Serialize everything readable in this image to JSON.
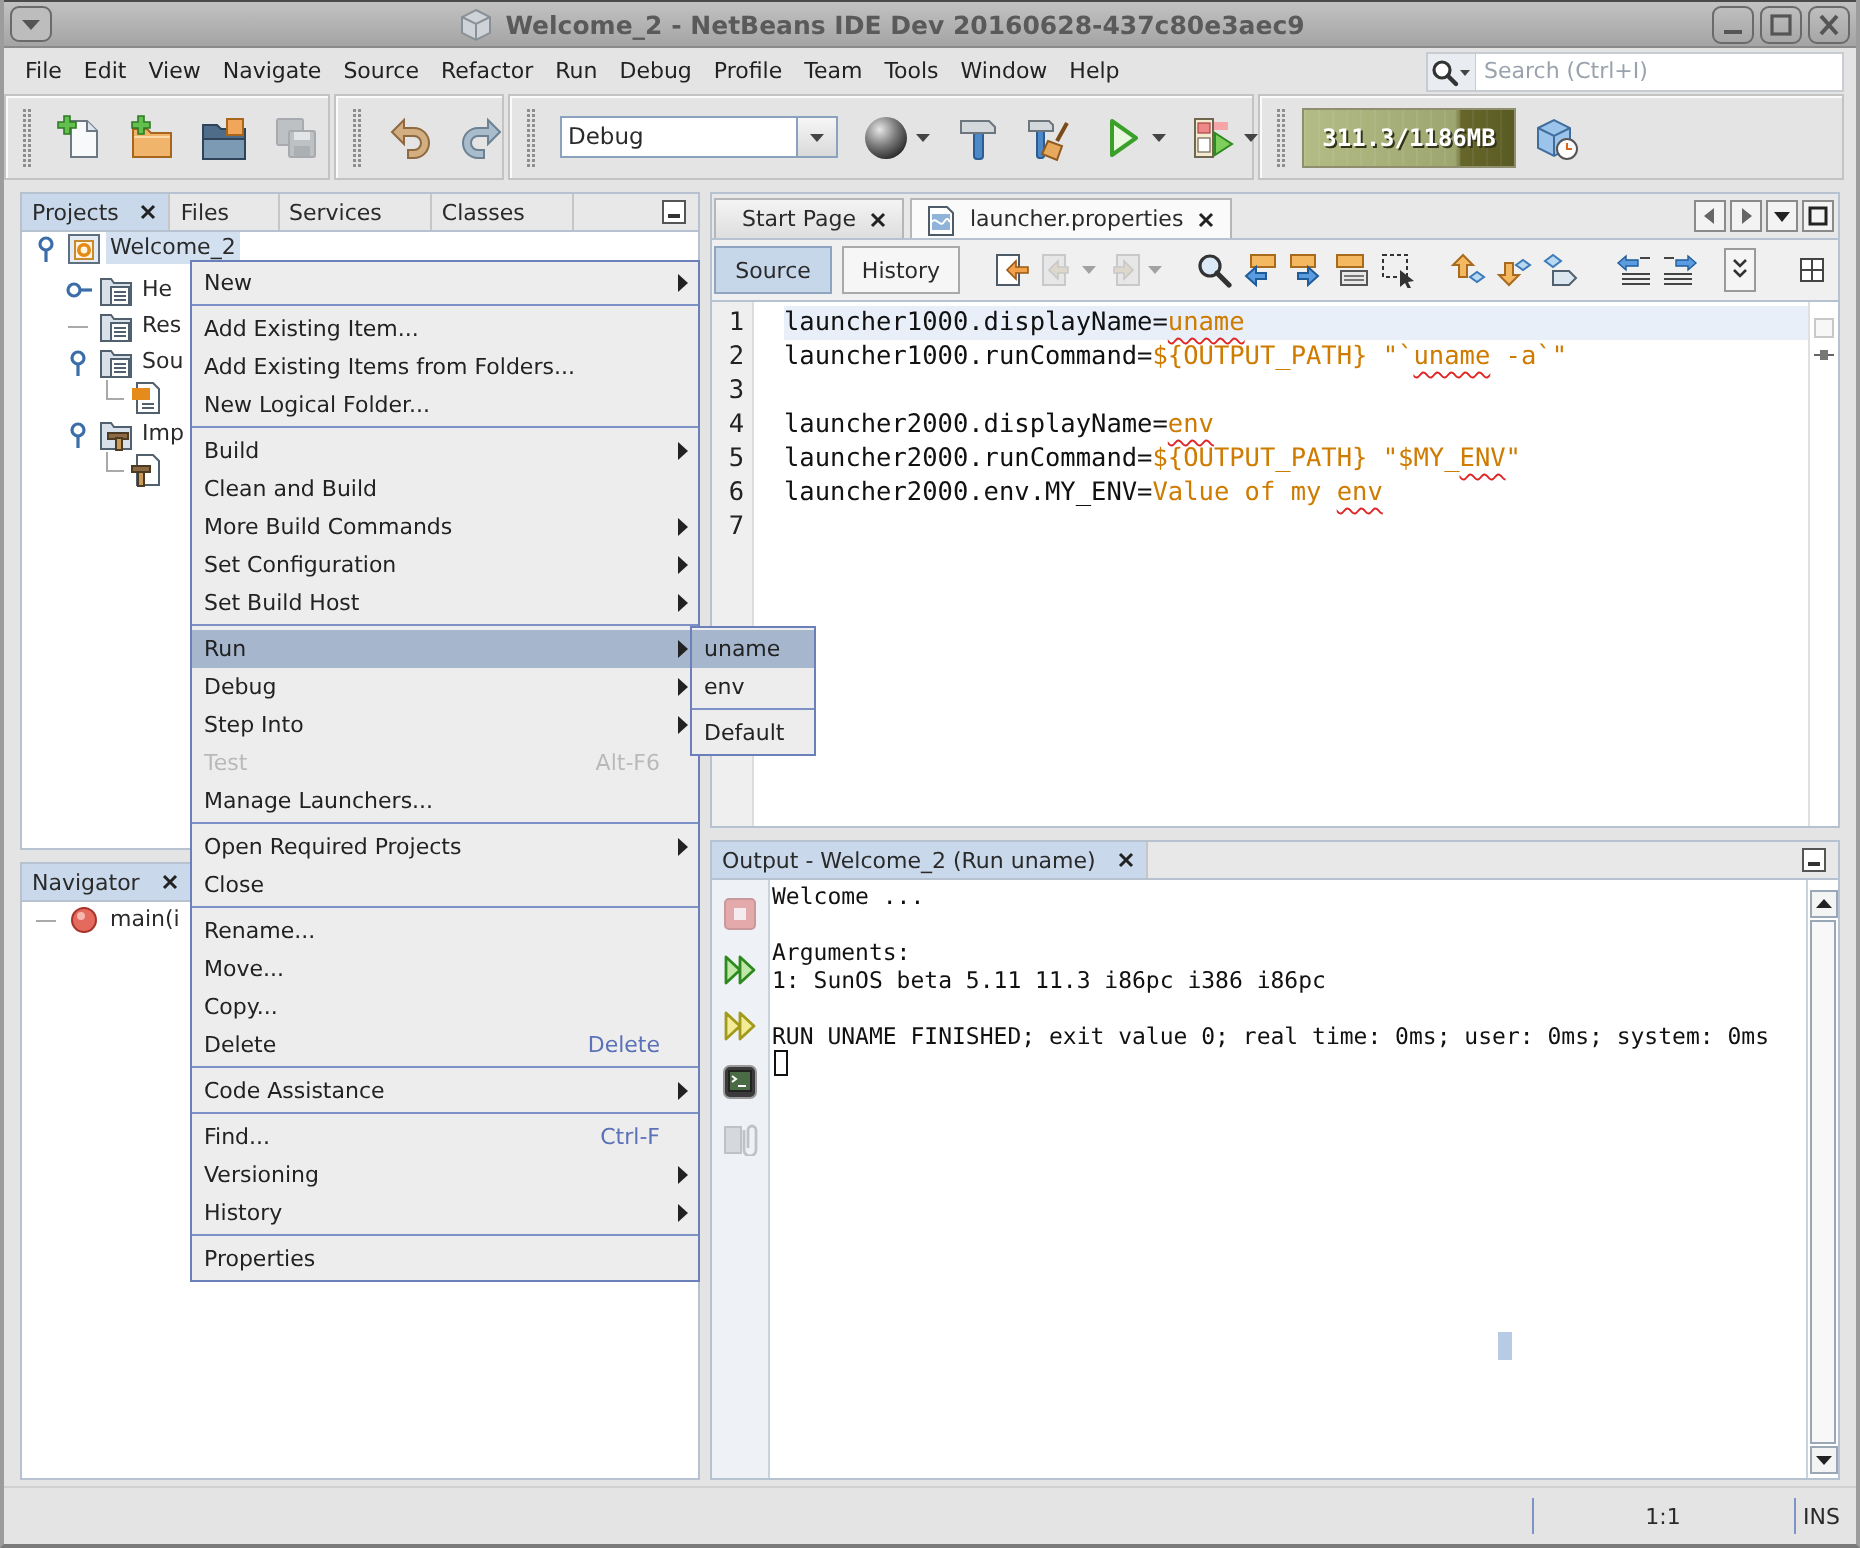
{
  "window": {
    "title": "Welcome_2 - NetBeans IDE Dev 20160628-437c80e3aec9"
  },
  "menu_bar": {
    "items": [
      "File",
      "Edit",
      "View",
      "Navigate",
      "Source",
      "Refactor",
      "Run",
      "Debug",
      "Profile",
      "Team",
      "Tools",
      "Window",
      "Help"
    ],
    "search": {
      "placeholder": "Search (Ctrl+I)"
    }
  },
  "toolbar": {
    "file_buttons": [
      {
        "kind": "new-file",
        "disabled": false
      },
      {
        "kind": "new-project",
        "disabled": false
      },
      {
        "kind": "open-project",
        "disabled": false
      },
      {
        "kind": "save-all",
        "disabled": true
      }
    ],
    "edit_buttons": [
      {
        "kind": "undo",
        "disabled": false
      },
      {
        "kind": "redo",
        "disabled": false
      }
    ],
    "configuration": "Debug",
    "build_buttons": [
      {
        "kind": "globe",
        "disabled": false
      },
      {
        "kind": "build",
        "disabled": false
      },
      {
        "kind": "clean-build",
        "disabled": false
      },
      {
        "kind": "run",
        "disabled": false
      },
      {
        "kind": "debug",
        "disabled": false
      }
    ],
    "memory": "311.3/1186MB"
  },
  "projects_panel": {
    "tabs": [
      {
        "label": "Projects",
        "selected": true
      },
      {
        "label": "Files",
        "selected": false
      },
      {
        "label": "Services",
        "selected": false
      },
      {
        "label": "Classes",
        "selected": false
      }
    ],
    "tree": [
      {
        "label": "Welcome_2",
        "kind": "project",
        "selected": true,
        "expanded": true,
        "children": [
          {
            "label": "He",
            "kind": "folder",
            "selected": false,
            "expanded": false
          },
          {
            "label": "Res",
            "kind": "folder",
            "selected": false
          },
          {
            "label": "Sou",
            "kind": "folder",
            "selected": false,
            "expanded": true,
            "children": [
              {
                "kind": "source",
                "selected": false
              }
            ]
          },
          {
            "label": "Imp",
            "kind": "tools",
            "selected": false,
            "expanded": true,
            "children": [
              {
                "kind": "makefile",
                "selected": false
              }
            ]
          }
        ]
      }
    ]
  },
  "navigator": {
    "tabs": [
      {
        "label": "Navigator",
        "selected": true
      }
    ],
    "items": [
      {
        "label": "main(i",
        "kind": "function"
      }
    ]
  },
  "editor": {
    "tabs": [
      {
        "label": "Start Page",
        "kind": "page",
        "selected": false
      },
      {
        "label": "launcher.properties",
        "kind": "file",
        "selected": true
      }
    ],
    "views": [
      {
        "label": "Source",
        "selected": true
      },
      {
        "label": "History",
        "selected": false
      }
    ],
    "tools": [
      {
        "kind": "last-edit",
        "disabled": false
      },
      {
        "kind": "back",
        "disabled": true
      },
      {
        "kind": "forward",
        "disabled": true
      },
      {
        "kind": "find",
        "disabled": false
      },
      {
        "kind": "find-previous",
        "disabled": false
      },
      {
        "kind": "find-next",
        "disabled": false
      },
      {
        "kind": "highlight",
        "disabled": false
      },
      {
        "kind": "rect-select",
        "disabled": false
      },
      {
        "kind": "previous-bookmark",
        "disabled": false
      },
      {
        "kind": "next-bookmark",
        "disabled": false
      },
      {
        "kind": "toggle-bookmark",
        "disabled": false
      },
      {
        "kind": "shift-left",
        "disabled": false
      },
      {
        "kind": "shift-right",
        "disabled": false
      }
    ],
    "lines": [
      {
        "number": "1",
        "current": true,
        "tokens": [
          {
            "text": "launcher1000.displayName=",
            "kind": "key"
          },
          {
            "text": "uname",
            "kind": "typo"
          }
        ]
      },
      {
        "number": "2",
        "current": false,
        "tokens": [
          {
            "text": "launcher1000.runCommand=",
            "kind": "key"
          },
          {
            "text": "${OUTPUT_PATH} \"`",
            "kind": "value"
          },
          {
            "text": "uname",
            "kind": "typo"
          },
          {
            "text": " -a`\"",
            "kind": "value"
          }
        ]
      },
      {
        "number": "3",
        "current": false
      },
      {
        "number": "4",
        "current": false,
        "tokens": [
          {
            "text": "launcher2000.displayName=",
            "kind": "key"
          },
          {
            "text": "env",
            "kind": "typo"
          }
        ]
      },
      {
        "number": "5",
        "current": false,
        "tokens": [
          {
            "text": "launcher2000.runCommand=",
            "kind": "key"
          },
          {
            "text": "${OUTPUT_PATH} \"$MY_",
            "kind": "value"
          },
          {
            "text": "ENV",
            "kind": "typo"
          },
          {
            "text": "\"",
            "kind": "value"
          }
        ]
      },
      {
        "number": "6",
        "current": false,
        "tokens": [
          {
            "text": "launcher2000.env.MY_ENV=",
            "kind": "key"
          },
          {
            "text": "Value of my ",
            "kind": "value"
          },
          {
            "text": "env",
            "kind": "typo"
          }
        ]
      },
      {
        "number": "7",
        "current": false
      }
    ]
  },
  "output": {
    "tabs": [
      {
        "label": "Output - Welcome_2 (Run uname)",
        "selected": true
      }
    ],
    "tools": [
      {
        "kind": "stop",
        "disabled": true
      },
      {
        "kind": "rerun",
        "disabled": false
      },
      {
        "kind": "modify",
        "disabled": false
      },
      {
        "kind": "terminal",
        "disabled": false
      },
      {
        "kind": "options",
        "disabled": true
      }
    ],
    "blocks": [
      [
        "Welcome ..."
      ],
      [
        "Arguments:",
        "1: SunOS beta 5.11 11.3 i86pc i386 i86pc"
      ],
      [
        "RUN UNAME FINISHED; exit value 0; real time: 0ms; user: 0ms; system: 0ms"
      ]
    ]
  },
  "context_menu": {
    "groups": [
      [
        {
          "label": "New",
          "submenu": true,
          "selected": false,
          "disabled": false
        }
      ],
      [
        {
          "label": "Add Existing Item...",
          "submenu": false,
          "selected": false,
          "disabled": false
        },
        {
          "label": "Add Existing Items from Folders...",
          "submenu": false,
          "selected": false,
          "disabled": false
        },
        {
          "label": "New Logical Folder...",
          "submenu": false,
          "selected": false,
          "disabled": false
        }
      ],
      [
        {
          "label": "Build",
          "submenu": true,
          "selected": false,
          "disabled": false
        },
        {
          "label": "Clean and Build",
          "submenu": false,
          "selected": false,
          "disabled": false
        },
        {
          "label": "More Build Commands",
          "submenu": true,
          "selected": false,
          "disabled": false
        },
        {
          "label": "Set Configuration",
          "submenu": true,
          "selected": false,
          "disabled": false
        },
        {
          "label": "Set Build Host",
          "submenu": true,
          "selected": false,
          "disabled": false
        }
      ],
      [
        {
          "label": "Run",
          "submenu": true,
          "selected": true,
          "disabled": false
        },
        {
          "label": "Debug",
          "submenu": true,
          "selected": false,
          "disabled": false
        },
        {
          "label": "Step Into",
          "submenu": true,
          "selected": false,
          "disabled": false
        },
        {
          "label": "Test",
          "submenu": false,
          "selected": false,
          "disabled": true,
          "shortcut": "Alt-F6"
        },
        {
          "label": "Manage Launchers...",
          "submenu": false,
          "selected": false,
          "disabled": false
        }
      ],
      [
        {
          "label": "Open Required Projects",
          "submenu": true,
          "selected": false,
          "disabled": false
        },
        {
          "label": "Close",
          "submenu": false,
          "selected": false,
          "disabled": false
        }
      ],
      [
        {
          "label": "Rename...",
          "submenu": false,
          "selected": false,
          "disabled": false
        },
        {
          "label": "Move...",
          "submenu": false,
          "selected": false,
          "disabled": false
        },
        {
          "label": "Copy...",
          "submenu": false,
          "selected": false,
          "disabled": false
        },
        {
          "label": "Delete",
          "submenu": false,
          "selected": false,
          "disabled": false,
          "shortcut": "Delete"
        }
      ],
      [
        {
          "label": "Code Assistance",
          "submenu": true,
          "selected": false,
          "disabled": false
        }
      ],
      [
        {
          "label": "Find...",
          "submenu": false,
          "selected": false,
          "disabled": false,
          "shortcut": "Ctrl-F"
        },
        {
          "label": "Versioning",
          "submenu": true,
          "selected": false,
          "disabled": false
        },
        {
          "label": "History",
          "submenu": true,
          "selected": false,
          "disabled": false
        }
      ],
      [
        {
          "label": "Properties",
          "submenu": false,
          "selected": false,
          "disabled": false
        }
      ]
    ]
  },
  "run_submenu": {
    "groups": [
      [
        {
          "label": "uname",
          "selected": true
        },
        {
          "label": "env",
          "selected": false
        }
      ],
      [
        {
          "label": "Default",
          "selected": false
        }
      ]
    ]
  },
  "status_bar": {
    "position": "1:1",
    "mode": "INS"
  }
}
